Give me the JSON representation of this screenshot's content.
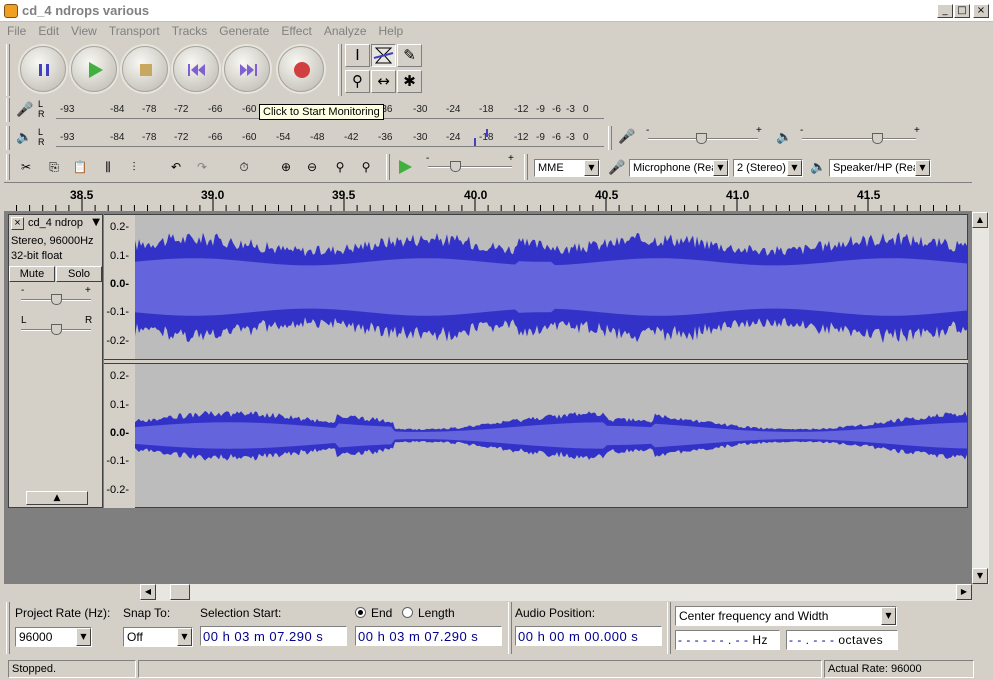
{
  "window": {
    "title": "cd_4 ndrops various",
    "minimize": "_",
    "maximize": "□",
    "close": "×"
  },
  "menu": [
    "File",
    "Edit",
    "View",
    "Transport",
    "Tracks",
    "Generate",
    "Effect",
    "Analyze",
    "Help"
  ],
  "meters": {
    "record_ticks": [
      "-93",
      "-84",
      "-78",
      "-72",
      "-66",
      "-60",
      "-36",
      "-30",
      "-24",
      "-18",
      "-12",
      "-9",
      "-6",
      "-3",
      "0"
    ],
    "play_ticks": [
      "-93",
      "-84",
      "-78",
      "-72",
      "-66",
      "-60",
      "-54",
      "-48",
      "-42",
      "-36",
      "-30",
      "-24",
      "-18",
      "-12",
      "-9",
      "-6",
      "-3",
      "0"
    ],
    "lr_label_l": "L",
    "lr_label_r": "R",
    "tooltip": "Click to Start Monitoring"
  },
  "device": {
    "host": "MME",
    "input_device": "Microphone (Rea",
    "channels": "2 (Stereo)",
    "output_device": "Speaker/HP (Rea"
  },
  "ruler": {
    "labels": [
      "38.5",
      "39.0",
      "39.5",
      "40.0",
      "40.5",
      "41.0",
      "41.5"
    ]
  },
  "track": {
    "name": "cd_4 ndrop",
    "close": "×",
    "format": "Stereo, 96000Hz",
    "bitdepth": "32-bit float",
    "mute": "Mute",
    "solo": "Solo",
    "gain_minus": "-",
    "gain_plus": "+",
    "pan_l": "L",
    "pan_r": "R",
    "yaxis_top": [
      "0.2-",
      "0.1-",
      "0.0-",
      "-0.1-",
      "-0.2-"
    ],
    "yaxis_bottom": [
      "0.2-",
      "0.1-",
      "0.0-",
      "-0.1-",
      "-0.2-"
    ]
  },
  "bottom": {
    "project_rate_label": "Project Rate (Hz):",
    "project_rate_value": "96000",
    "snap_label": "Snap To:",
    "snap_value": "Off",
    "selection_start_label": "Selection Start:",
    "selection_start_value": "00 h 03 m 07.290 s",
    "end_label": "End",
    "length_label": "Length",
    "selection_end_value": "00 h 03 m 07.290 s",
    "audio_position_label": "Audio Position:",
    "audio_position_value": "00 h 00 m 00.000 s",
    "spectral_mode": "Center frequency and Width",
    "freq_value": "- - - - - - . - -",
    "freq_unit": "Hz",
    "width_value": "- - . - - -",
    "width_unit": "octaves"
  },
  "status": {
    "left": "Stopped.",
    "right": "Actual Rate: 96000"
  },
  "colors": {
    "wave": "#3232c8",
    "wave_rms": "#6464dc",
    "wave_bg": "#bcbcbc",
    "track_bg": "#7f7f7f"
  }
}
